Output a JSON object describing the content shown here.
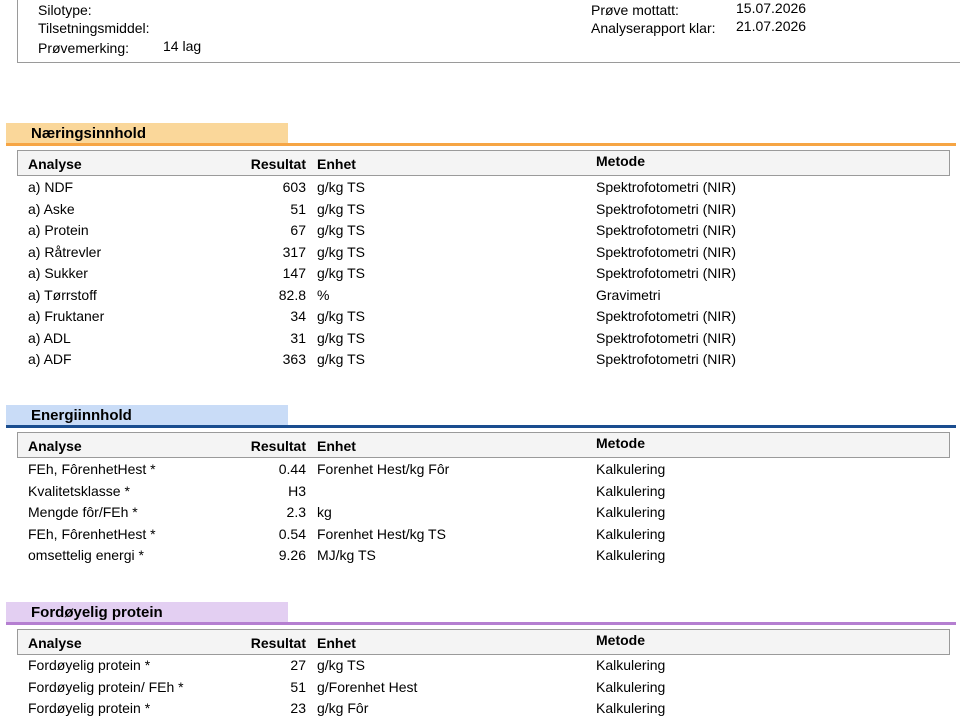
{
  "header_info": {
    "silotype_label": "Silotype:",
    "silotype_value": "",
    "tilsetningsmiddel_label": "Tilsetningsmiddel:",
    "tilsetningsmiddel_value": "",
    "provemerking_label": "Prøvemerking:",
    "provemerking_value": "14 lag",
    "prove_mottatt_label": "Prøve mottatt:",
    "prove_mottatt_value": "15.07.2026",
    "analyserapport_label": "Analyserapport klar:",
    "analyserapport_value": "21.07.2026"
  },
  "columns": {
    "analyse": "Analyse",
    "resultat": "Resultat",
    "enhet": "Enhet",
    "metode": "Metode"
  },
  "colors": {
    "naering": "#f6a544",
    "naering_bar": "#fad79a",
    "energi": "#1a4d8f",
    "energi_bar": "#c9dcf7",
    "protein": "#b57fd1",
    "protein_bar": "#e3cff2"
  },
  "sections": [
    {
      "title": "Næringsinnhold",
      "rows": [
        {
          "analyse": "a) NDF",
          "resultat": "603",
          "enhet": "g/kg TS",
          "metode": "Spektrofotometri (NIR)"
        },
        {
          "analyse": "a) Aske",
          "resultat": "51",
          "enhet": "g/kg TS",
          "metode": "Spektrofotometri (NIR)"
        },
        {
          "analyse": "a) Protein",
          "resultat": "67",
          "enhet": "g/kg TS",
          "metode": "Spektrofotometri (NIR)"
        },
        {
          "analyse": "a) Råtrevler",
          "resultat": "317",
          "enhet": "g/kg TS",
          "metode": "Spektrofotometri (NIR)"
        },
        {
          "analyse": "a) Sukker",
          "resultat": "147",
          "enhet": "g/kg TS",
          "metode": "Spektrofotometri (NIR)"
        },
        {
          "analyse": "a) Tørrstoff",
          "resultat": "82.8",
          "enhet": "%",
          "metode": "Gravimetri"
        },
        {
          "analyse": "a) Fruktaner",
          "resultat": "34",
          "enhet": "g/kg TS",
          "metode": "Spektrofotometri (NIR)"
        },
        {
          "analyse": "a) ADL",
          "resultat": "31",
          "enhet": "g/kg TS",
          "metode": "Spektrofotometri (NIR)"
        },
        {
          "analyse": "a) ADF",
          "resultat": "363",
          "enhet": "g/kg TS",
          "metode": "Spektrofotometri (NIR)"
        }
      ]
    },
    {
      "title": "Energiinnhold",
      "rows": [
        {
          "analyse": "FEh, FôrenhetHest *",
          "resultat": "0.44",
          "enhet": "Forenhet Hest/kg Fôr",
          "metode": "Kalkulering"
        },
        {
          "analyse": "Kvalitetsklasse *",
          "resultat": "H3",
          "enhet": "",
          "metode": "Kalkulering"
        },
        {
          "analyse": "Mengde fôr/FEh *",
          "resultat": "2.3",
          "enhet": "kg",
          "metode": "Kalkulering"
        },
        {
          "analyse": "FEh, FôrenhetHest *",
          "resultat": "0.54",
          "enhet": "Forenhet Hest/kg TS",
          "metode": "Kalkulering"
        },
        {
          "analyse": "omsettelig energi *",
          "resultat": "9.26",
          "enhet": "MJ/kg TS",
          "metode": "Kalkulering"
        }
      ]
    },
    {
      "title": "Fordøyelig protein",
      "rows": [
        {
          "analyse": "Fordøyelig protein *",
          "resultat": "27",
          "enhet": "g/kg TS",
          "metode": "Kalkulering"
        },
        {
          "analyse": "Fordøyelig protein/ FEh *",
          "resultat": "51",
          "enhet": "g/Forenhet Hest",
          "metode": "Kalkulering"
        },
        {
          "analyse": "Fordøyelig protein *",
          "resultat": "23",
          "enhet": "g/kg Fôr",
          "metode": "Kalkulering"
        }
      ]
    }
  ]
}
